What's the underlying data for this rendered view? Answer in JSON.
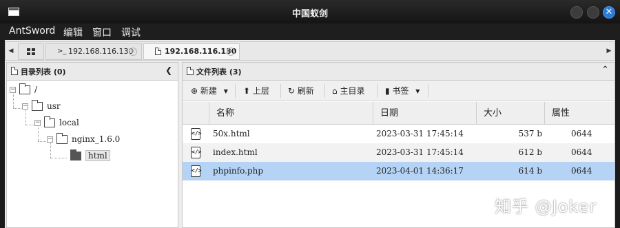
{
  "window": {
    "title": "中国蚁剑"
  },
  "menu": [
    "AntSword",
    "编辑",
    "窗口",
    "调试"
  ],
  "tabs": [
    {
      "label": "192.168.116.130",
      "icon": "terminal-icon"
    },
    {
      "label": "192.168.116.130",
      "icon": "page-icon"
    }
  ],
  "dir_panel": {
    "title": "目录列表 (0)"
  },
  "tree": {
    "root": "/",
    "usr": "usr",
    "local": "local",
    "nginx": "nginx_1.6.0",
    "html": "html"
  },
  "file_panel": {
    "title": "文件列表 (3)"
  },
  "toolbar": {
    "new": "新建",
    "up": "上层",
    "refresh": "刷新",
    "home": "主目录",
    "bookmark": "书签"
  },
  "columns": {
    "name": "名称",
    "date": "日期",
    "size": "大小",
    "attr": "属性"
  },
  "files": [
    {
      "name": "50x.html",
      "date": "2023-03-31 17:45:14",
      "size": "537 b",
      "attr": "0644"
    },
    {
      "name": "index.html",
      "date": "2023-03-31 17:45:14",
      "size": "612 b",
      "attr": "0644"
    },
    {
      "name": "phpinfo.php",
      "date": "2023-04-01 14:36:17",
      "size": "614 b",
      "attr": "0644"
    }
  ],
  "watermark": "知乎 @Joker",
  "colors": {
    "selected_row": "#b5d4f5",
    "close_button": "#2a7ad8"
  }
}
